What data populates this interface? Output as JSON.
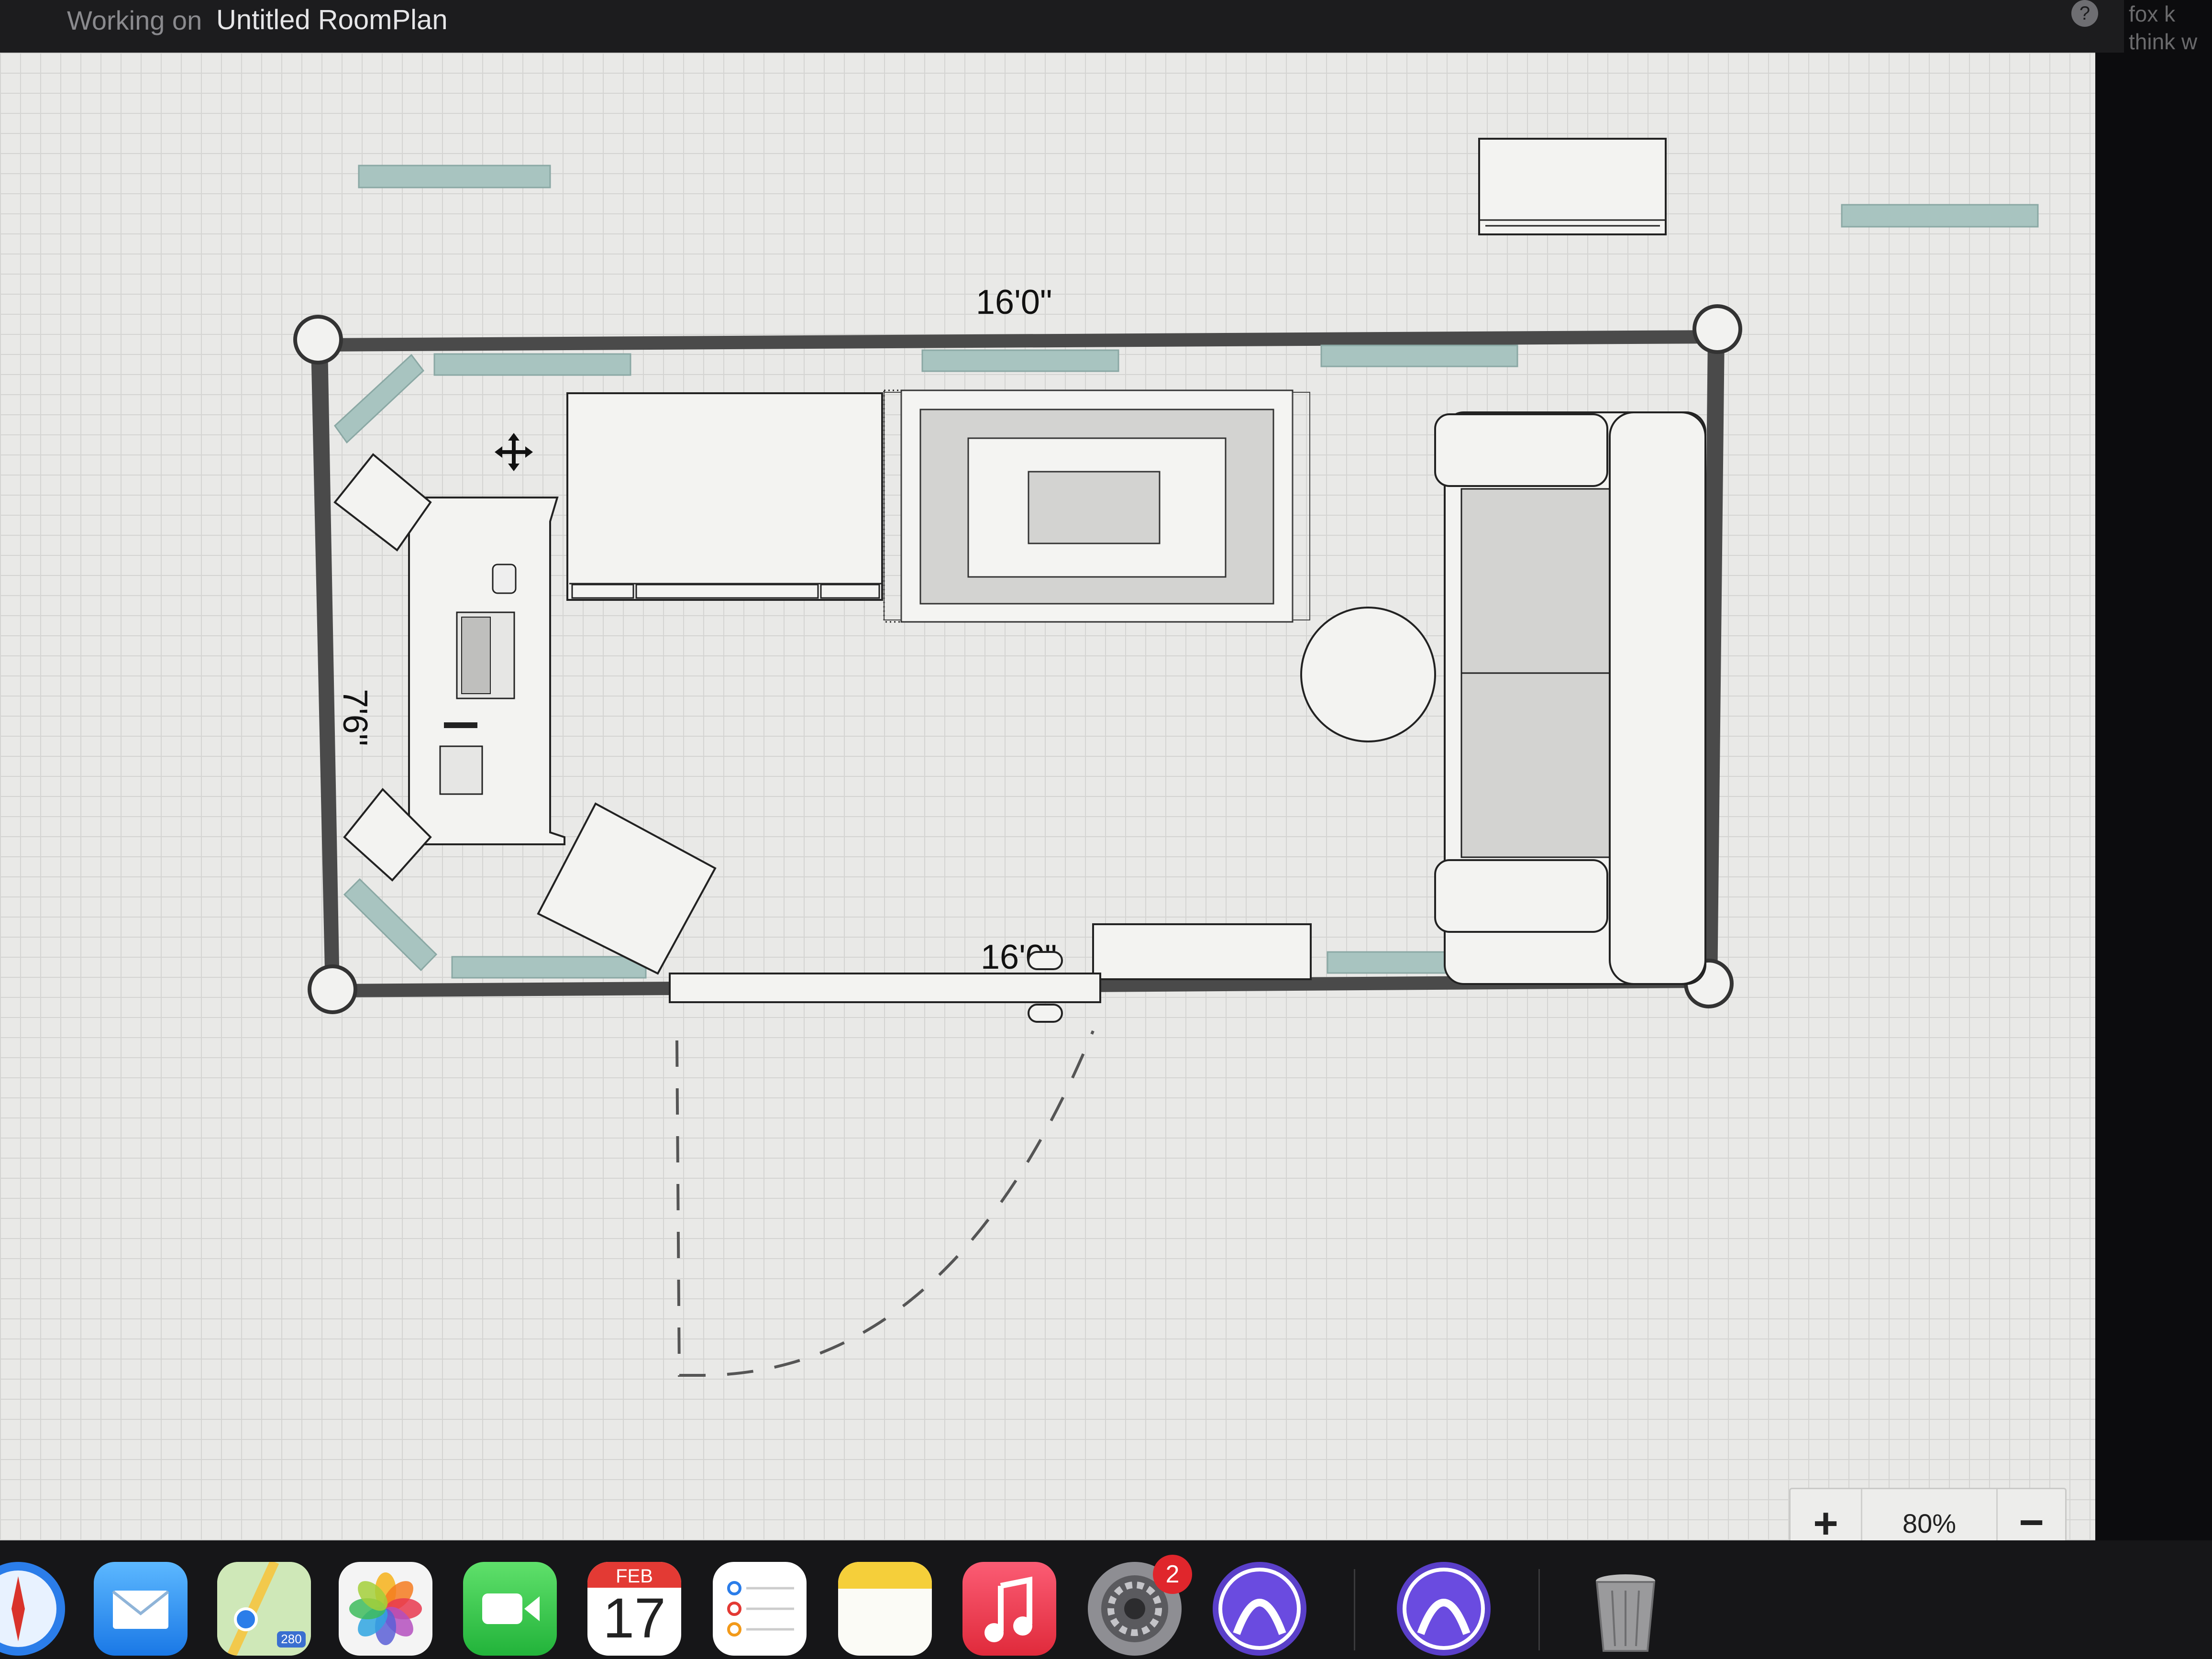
{
  "window": {
    "title_prefix": "Working on",
    "title_name": "Untitled RoomPlan",
    "help_label": "?",
    "side_text": [
      "fox k",
      "think w"
    ]
  },
  "plan": {
    "dimensions": {
      "top_width": "16'0\"",
      "bottom_width": "16'0\"",
      "left_height": "7'6\""
    }
  },
  "zoom": {
    "zoom_in_label": "+",
    "zoom_level": "80%",
    "zoom_out_label": "−"
  },
  "dock": {
    "apps": [
      {
        "name": "Safari",
        "icon": "safari-icon"
      },
      {
        "name": "Mail",
        "icon": "mail-icon"
      },
      {
        "name": "Maps",
        "icon": "maps-icon",
        "badge_text": "280"
      },
      {
        "name": "Photos",
        "icon": "photos-icon"
      },
      {
        "name": "FaceTime",
        "icon": "facetime-icon"
      },
      {
        "name": "Calendar",
        "icon": "calendar-icon"
      },
      {
        "name": "Reminders",
        "icon": "reminders-icon"
      },
      {
        "name": "Notes",
        "icon": "notes-icon"
      },
      {
        "name": "Music",
        "icon": "music-icon"
      },
      {
        "name": "System Settings",
        "icon": "settings-icon"
      },
      {
        "name": "RoomPlan",
        "icon": "roomplan-app-icon"
      },
      {
        "name": "RoomPlan",
        "icon": "roomplan-app-icon"
      },
      {
        "name": "Trash",
        "icon": "trash-icon"
      }
    ],
    "calendar": {
      "month": "FEB",
      "day": "17"
    },
    "settings_badge": "2"
  },
  "colors": {
    "wall": "#4a4a4a",
    "window": "#a8c4c0",
    "canvas": "#e9e9e7",
    "grid": "#d4d4d2"
  }
}
